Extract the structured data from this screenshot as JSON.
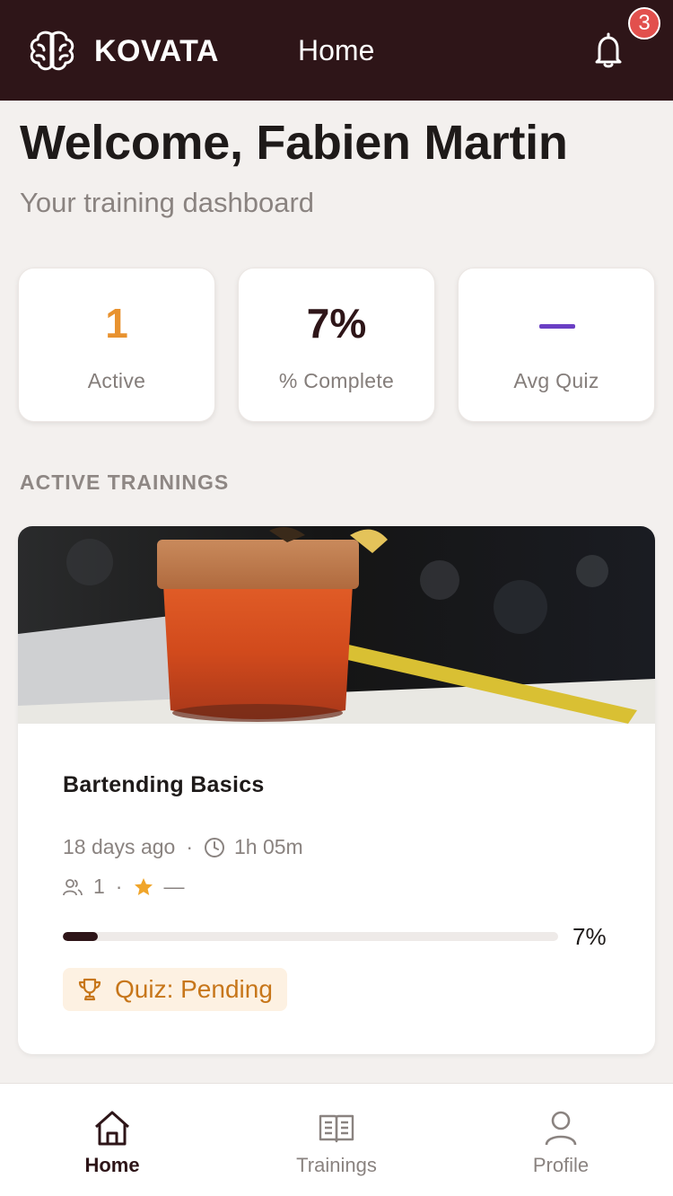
{
  "header": {
    "brand": "KOVATA",
    "title": "Home",
    "notification_count": "3"
  },
  "welcome": {
    "title": "Welcome, Fabien Martin",
    "subtitle": "Your training dashboard"
  },
  "stats": [
    {
      "value": "1",
      "label": "Active",
      "color": "#e8922f"
    },
    {
      "value": "7%",
      "label": "% Complete",
      "color": "#2e1518"
    },
    {
      "value": "",
      "label": "Avg Quiz",
      "color": "#6a3fc4"
    }
  ],
  "section_heading": "ACTIVE TRAININGS",
  "training": {
    "title": "Bartending Basics",
    "time_ago": "18 days ago",
    "duration": "1h 05m",
    "participants": "1",
    "rating": "—",
    "progress": 0.07,
    "progress_label": "7%",
    "quiz_status": "Quiz: Pending"
  },
  "bottom_nav": [
    {
      "label": "Home",
      "icon": "home-icon",
      "active": true
    },
    {
      "label": "Trainings",
      "icon": "book-icon",
      "active": false
    },
    {
      "label": "Profile",
      "icon": "user-icon",
      "active": false
    }
  ],
  "colors": {
    "header_bg": "#2e1518",
    "accent_orange": "#e8922f",
    "accent_purple": "#6a3fc4",
    "badge_red": "#e2504d",
    "quiz_text": "#c7761a"
  }
}
